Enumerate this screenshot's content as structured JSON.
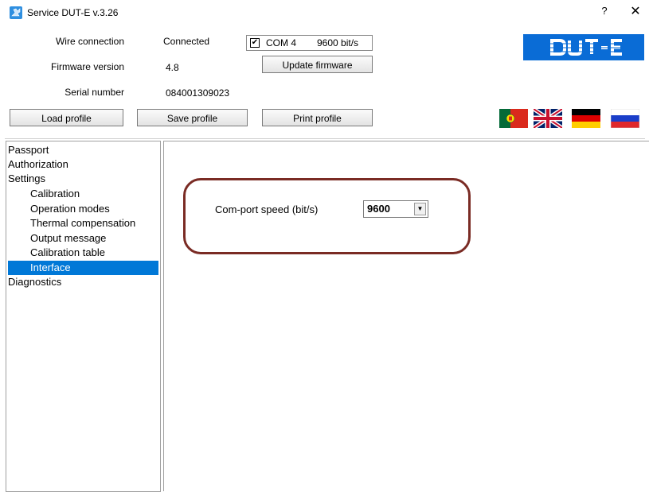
{
  "window": {
    "title": "Service DUT-E  v.3.26",
    "help_glyph": "?",
    "close_glyph": "✕"
  },
  "info": {
    "wire_label": "Wire connection",
    "wire_value": "Connected",
    "firmware_label": "Firmware version",
    "firmware_value": "4.8",
    "serial_label": "Serial number",
    "serial_value": "084001309023"
  },
  "com": {
    "checked": true,
    "check_glyph": "✔",
    "port": "COM 4",
    "speed": "9600 bit/s"
  },
  "buttons": {
    "update_firmware": "Update firmware",
    "load_profile": "Load profile",
    "save_profile": "Save profile",
    "print_profile": "Print profile"
  },
  "logo": {
    "text": "DUT-E",
    "color": "#0a6cd6"
  },
  "flags": [
    "portugal-flag-icon",
    "uk-flag-icon",
    "germany-flag-icon",
    "russia-flag-icon"
  ],
  "tree": {
    "items": [
      {
        "label": "Passport"
      },
      {
        "label": "Authorization"
      },
      {
        "label": "Settings"
      },
      {
        "label": "Calibration"
      },
      {
        "label": "Operation modes"
      },
      {
        "label": "Thermal compensation"
      },
      {
        "label": "Output message"
      },
      {
        "label": "Calibration table"
      },
      {
        "label": "Interface"
      },
      {
        "label": "Diagnostics"
      }
    ],
    "selected": "Interface",
    "selection_color": "#0078d7"
  },
  "interface": {
    "speed_label": "Com-port speed (bit/s)",
    "speed_value": "9600",
    "highlight_color": "#7a2b24"
  }
}
